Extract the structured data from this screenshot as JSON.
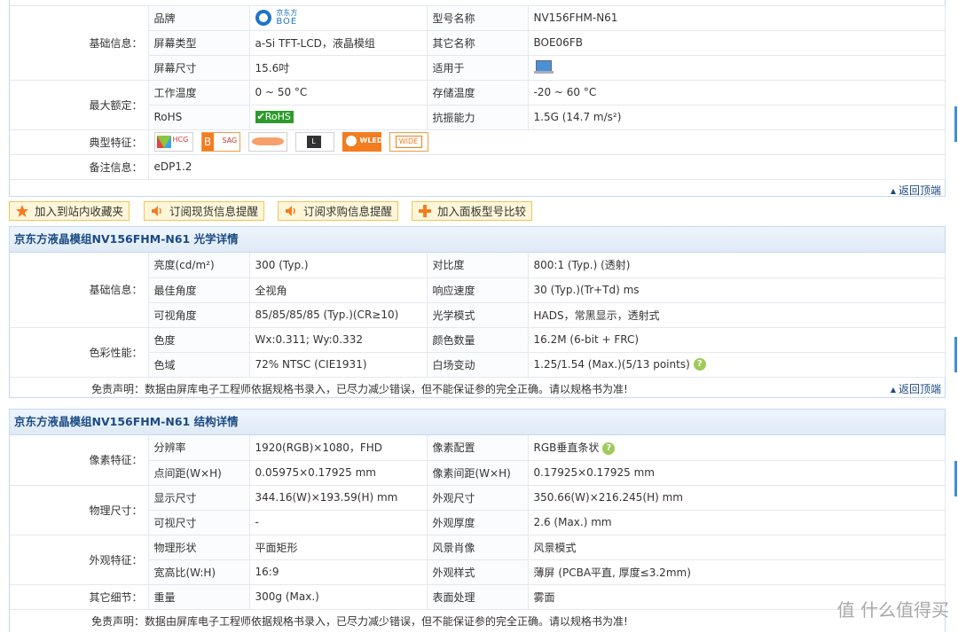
{
  "basic": {
    "group_basic": "基础信息：",
    "group_rating": "最大额定：",
    "group_feature": "典型特征：",
    "group_note": "备注信息：",
    "brand_label": "品牌",
    "brand_logo_cn": "京东方",
    "brand_logo_en": "BOE",
    "model_label": "型号名称",
    "model_value": "NV156FHM-N61",
    "screen_type_label": "屏幕类型",
    "screen_type_value": "a-Si TFT-LCD，液晶模组",
    "other_name_label": "其它名称",
    "other_name_value": "BOE06FB",
    "size_label": "屏幕尺寸",
    "size_value": "15.6吋",
    "apply_label": "适用于",
    "op_temp_label": "工作温度",
    "op_temp_value": "0 ~ 50 °C",
    "store_temp_label": "存储温度",
    "store_temp_value": "-20 ~ 60 °C",
    "rohs_label": "RoHS",
    "rohs_badge": "RoHS",
    "vib_label": "抗振能力",
    "vib_value": "1.5G (14.7 m/s²)",
    "features": [
      "HCG",
      "SAG",
      "",
      "L",
      "WLED",
      "WIDE"
    ],
    "note_value": "eDP1.2",
    "back_top": "返回顶端"
  },
  "actions": [
    {
      "label": "加入到站内收藏夹",
      "icon": "star-icon"
    },
    {
      "label": "订阅现货信息提醒",
      "icon": "speaker-icon"
    },
    {
      "label": "订阅求购信息提醒",
      "icon": "speaker-icon"
    },
    {
      "label": "加入面板型号比较",
      "icon": "plus-icon"
    }
  ],
  "optical": {
    "title": "京东方液晶模组NV156FHM-N61 光学详情",
    "group_basic": "基础信息：",
    "group_color": "色彩性能：",
    "rows": [
      {
        "l1": "亮度(cd/m²)",
        "v1": "300 (Typ.)",
        "l2": "对比度",
        "v2": "800:1 (Typ.) (透射)"
      },
      {
        "l1": "最佳角度",
        "v1": "全视角",
        "l2": "响应速度",
        "v2": "30 (Typ.)(Tr+Td) ms"
      },
      {
        "l1": "可视角度",
        "v1": "85/85/85/85 (Typ.)(CR≥10)",
        "l2": "光学模式",
        "v2": "HADS，常黑显示，透射式"
      },
      {
        "l1": "色度",
        "v1": "Wx:0.311; Wy:0.332",
        "l2": "颜色数量",
        "v2": "16.2M (6-bit + FRC)"
      },
      {
        "l1": "色域",
        "v1": "72% NTSC (CIE1931)",
        "l2": "白场变动",
        "v2": "1.25/1.54 (Max.)(5/13 points)"
      }
    ],
    "disclaimer": "免责声明：数据由屏库电子工程师依据规格书录入，已尽力减少错误，但不能保证参的完全正确。请以规格书为准!",
    "back_top": "返回顶端"
  },
  "structure": {
    "title": "京东方液晶模组NV156FHM-N61 结构详情",
    "group_pixel": "像素特征：",
    "group_physical": "物理尺寸：",
    "group_look": "外观特征：",
    "group_other": "其它细节：",
    "rows": [
      {
        "l1": "分辨率",
        "v1": "1920(RGB)×1080，FHD",
        "l2": "像素配置",
        "v2": "RGB垂直条状"
      },
      {
        "l1": "点间距(W×H)",
        "v1": "0.05975×0.17925 mm",
        "l2": "像素间距(W×H)",
        "v2": "0.17925×0.17925 mm"
      },
      {
        "l1": "显示尺寸",
        "v1": "344.16(W)×193.59(H) mm",
        "l2": "外观尺寸",
        "v2": "350.66(W)×216.245(H) mm"
      },
      {
        "l1": "可视尺寸",
        "v1": "-",
        "l2": "外观厚度",
        "v2": "2.6 (Max.) mm"
      },
      {
        "l1": "物理形状",
        "v1": "平面矩形",
        "l2": "风景肖像",
        "v2": "风景模式"
      },
      {
        "l1": "宽高比(W:H)",
        "v1": "16:9",
        "l2": "外观样式",
        "v2": "薄屏 (PCBA平直, 厚度≤3.2mm)"
      },
      {
        "l1": "重量",
        "v1": "300g (Max.)",
        "l2": "表面处理",
        "v2": "雾面"
      }
    ],
    "disclaimer": "免责声明：数据由屏库电子工程师依据规格书录入，已尽力减少错误，但不能保证参的完全正确。请以规格书为准!"
  },
  "watermark": "值 什么值得买",
  "colors": {
    "accent": "#1b4a83",
    "border": "#c6d9ec",
    "button_bg": "#fff6d9",
    "button_border": "#f0c45a"
  }
}
